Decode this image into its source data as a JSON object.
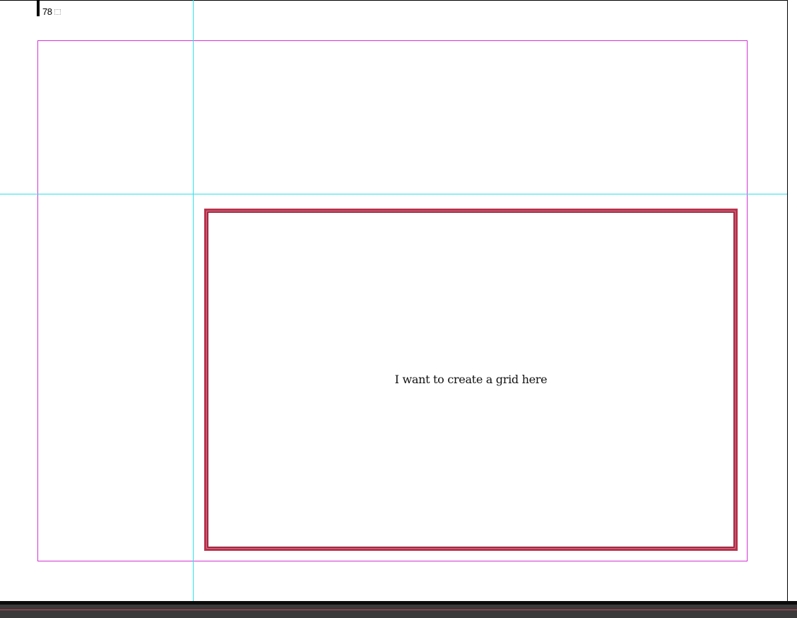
{
  "page": {
    "number": "78",
    "frame_text": "I want to create a grid here"
  },
  "colors": {
    "margin_guide": "#d233d2",
    "ruler_guide": "#2ee0ee",
    "selected_frame": "#b7334b",
    "pasteboard_bar": "#3a3a3a"
  }
}
